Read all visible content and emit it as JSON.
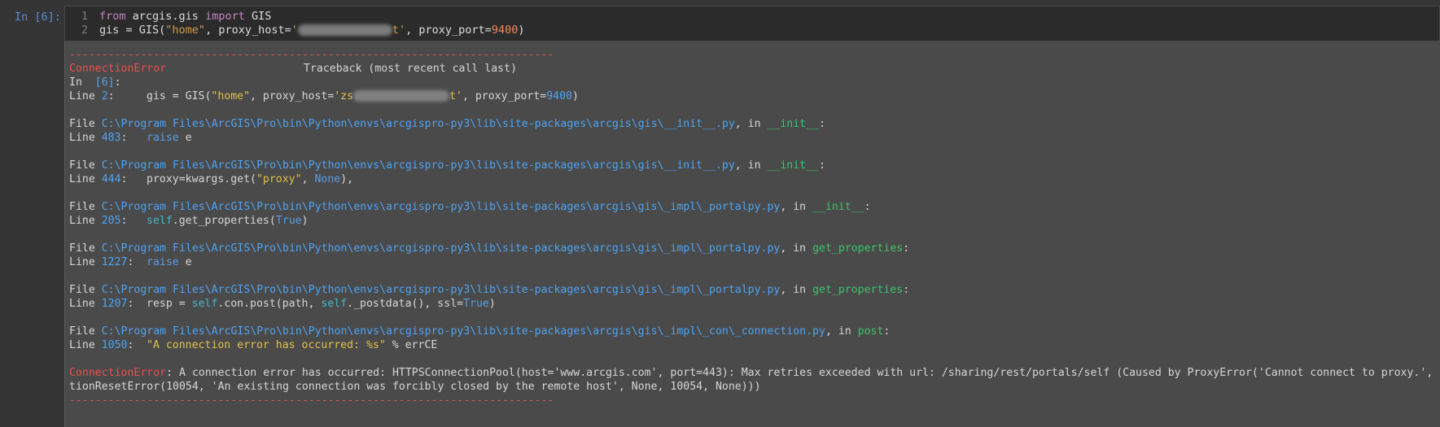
{
  "prompt": "In [6]:",
  "code": {
    "line1": {
      "num": "1",
      "kw_from": "from",
      "module": " arcgis.gis ",
      "kw_import": "import",
      "name": " GIS"
    },
    "line2": {
      "num": "2",
      "pre": "gis = GIS(",
      "str1": "\"home\"",
      "mid": ", proxy_host=",
      "str2_start": "'",
      "str2_end": "t'",
      "post": ", proxy_port=",
      "port": "9400",
      "end": ")"
    }
  },
  "traceback": {
    "dashes": "---------------------------------------------------------------------------",
    "header_error": "ConnectionError",
    "header_right": "Traceback (most recent call last)",
    "in_label": "In  ",
    "in_ref": "[6]",
    "in_colon": ":",
    "line_label": "Line ",
    "first": {
      "num": "2",
      "pre": "gis = GIS(",
      "str1": "\"home\"",
      "mid": ", proxy_host=",
      "str2_start": "'zs",
      "str2_end": "t'",
      "post": ", proxy_port=",
      "port": "9400",
      "end": ")"
    },
    "frames": [
      {
        "path": "C:\\Program Files\\ArcGIS\\Pro\\bin\\Python\\envs\\arcgispro-py3\\lib\\site-packages\\arcgis\\gis\\__init__.py",
        "func": "__init__",
        "line": "483",
        "code": [
          {
            "t": "raise",
            "c": "kwc"
          },
          {
            "t": " e",
            "c": ""
          }
        ]
      },
      {
        "path": "C:\\Program Files\\ArcGIS\\Pro\\bin\\Python\\envs\\arcgispro-py3\\lib\\site-packages\\arcgis\\gis\\__init__.py",
        "func": "__init__",
        "line": "444",
        "code": [
          {
            "t": "proxy=kwargs.get(",
            "c": ""
          },
          {
            "t": "\"proxy\"",
            "c": "ystr"
          },
          {
            "t": ", ",
            "c": ""
          },
          {
            "t": "None",
            "c": "kwc"
          },
          {
            "t": "),",
            "c": ""
          }
        ]
      },
      {
        "path": "C:\\Program Files\\ArcGIS\\Pro\\bin\\Python\\envs\\arcgispro-py3\\lib\\site-packages\\arcgis\\gis\\_impl\\_portalpy.py",
        "func": "__init__",
        "line": "205",
        "code": [
          {
            "t": "self",
            "c": "bi"
          },
          {
            "t": ".get_properties(",
            "c": ""
          },
          {
            "t": "True",
            "c": "kwc"
          },
          {
            "t": ")",
            "c": ""
          }
        ]
      },
      {
        "path": "C:\\Program Files\\ArcGIS\\Pro\\bin\\Python\\envs\\arcgispro-py3\\lib\\site-packages\\arcgis\\gis\\_impl\\_portalpy.py",
        "func": "get_properties",
        "line": "1227",
        "code": [
          {
            "t": "raise",
            "c": "kwc"
          },
          {
            "t": " e",
            "c": ""
          }
        ]
      },
      {
        "path": "C:\\Program Files\\ArcGIS\\Pro\\bin\\Python\\envs\\arcgispro-py3\\lib\\site-packages\\arcgis\\gis\\_impl\\_portalpy.py",
        "func": "get_properties",
        "line": "1207",
        "code": [
          {
            "t": "resp = ",
            "c": ""
          },
          {
            "t": "self",
            "c": "bi"
          },
          {
            "t": ".con.post(path, ",
            "c": ""
          },
          {
            "t": "self",
            "c": "bi"
          },
          {
            "t": "._postdata(), ssl=",
            "c": ""
          },
          {
            "t": "True",
            "c": "kwc"
          },
          {
            "t": ")",
            "c": ""
          }
        ]
      },
      {
        "path": "C:\\Program Files\\ArcGIS\\Pro\\bin\\Python\\envs\\arcgispro-py3\\lib\\site-packages\\arcgis\\gis\\_impl\\_con\\_connection.py",
        "func": "post",
        "line": "1050",
        "code": [
          {
            "t": "\"A connection error has occurred: %s\"",
            "c": "ystr"
          },
          {
            "t": " % errCE",
            "c": ""
          }
        ]
      }
    ],
    "file_label": "File ",
    "in_word": ", in ",
    "colon": ":",
    "final_error": "ConnectionError",
    "final_msg_1": ": A connection error has occurred: HTTPSConnectionPool(host='www.arcgis.com', port=443): Max retries exceeded with url: /sharing/rest/portals/self (Caused by ProxyError('Cannot connect to proxy.', Connec",
    "final_msg_2": "tionResetError(10054, 'An existing connection was forcibly closed by the remote host', None, 10054, None)))"
  }
}
